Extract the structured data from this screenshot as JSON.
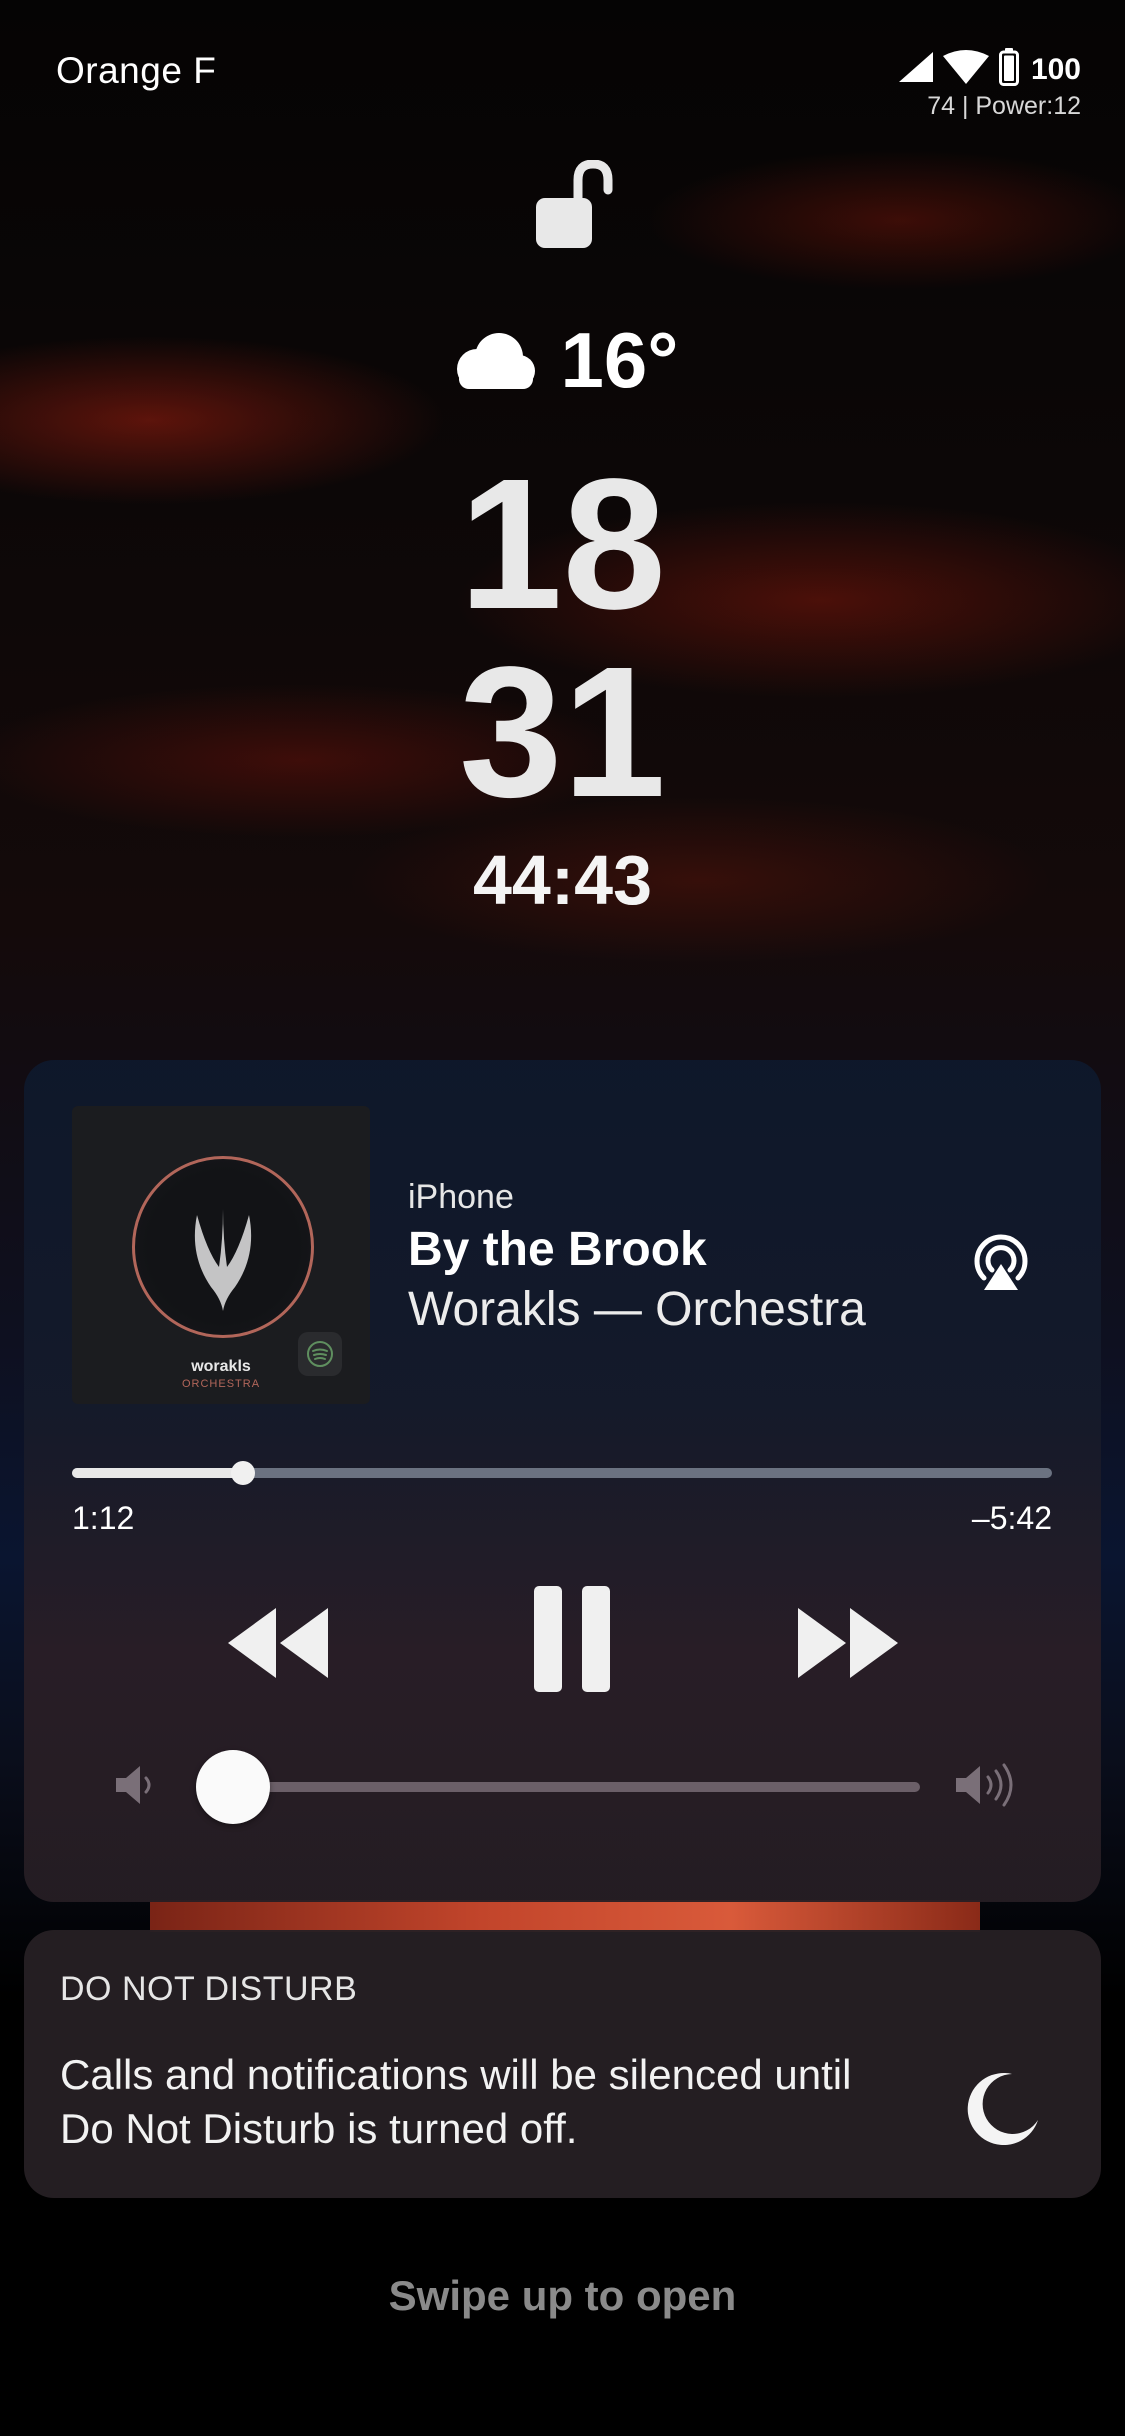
{
  "status_bar": {
    "carrier": "Orange F",
    "battery_percent": "100",
    "sub_info": "74 | Power:12",
    "icons": [
      "cellular-signal-icon",
      "wifi-icon",
      "battery-icon"
    ]
  },
  "lock": {
    "icon": "unlocked-padlock-icon"
  },
  "weather": {
    "icon": "cloud-icon",
    "temperature": "16°"
  },
  "clock": {
    "hours": "18",
    "minutes": "31",
    "seconds": "44:43"
  },
  "now_playing": {
    "source": "iPhone",
    "title": "By the Brook",
    "subtitle": "Worakls — Orchestra",
    "album_art": {
      "artist": "worakls",
      "album": "ORCHESTRA"
    },
    "elapsed": "1:12",
    "remaining": "–5:42",
    "progress": 0.174,
    "volume": 0.04,
    "icons": {
      "airplay": "airplay-icon",
      "rewind": "rewind-icon",
      "pause": "pause-icon",
      "forward": "fast-forward-icon",
      "volume_low": "volume-low-icon",
      "volume_high": "volume-high-icon"
    }
  },
  "do_not_disturb": {
    "title": "DO NOT DISTURB",
    "message": "Calls and notifications will be silenced until Do Not Disturb is turned off.",
    "icon": "moon-icon"
  },
  "hint": {
    "swipe": "Swipe up to open"
  },
  "colors": {
    "card_top": "#0e182c",
    "card_bottom": "#261e24",
    "text_primary": "#ffffff",
    "text_muted": "#8a8a8a",
    "album_accent": "#b2665a"
  }
}
